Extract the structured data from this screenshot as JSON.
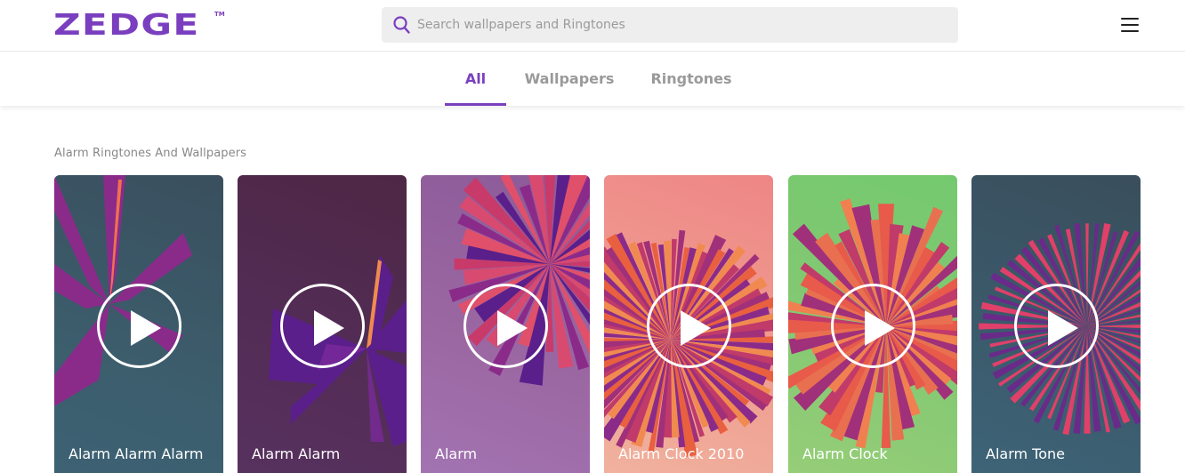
{
  "header": {
    "logo_text": "ZEDGE",
    "logo_tm": "TM",
    "search": {
      "placeholder": "Search wallpapers and Ringtones",
      "value": ""
    },
    "menu_icon": "hamburger-menu-icon"
  },
  "tabs": [
    {
      "label": "All",
      "active": true
    },
    {
      "label": "Wallpapers",
      "active": false
    },
    {
      "label": "Ringtones",
      "active": false
    }
  ],
  "section": {
    "title": "Alarm Ringtones And Wallpapers",
    "items": [
      {
        "title": "Alarm Alarm Alarm",
        "type": "ringtone",
        "icon": "play-icon"
      },
      {
        "title": "Alarm Alarm",
        "type": "ringtone",
        "icon": "play-icon"
      },
      {
        "title": "Alarm",
        "type": "ringtone",
        "icon": "play-icon"
      },
      {
        "title": "Alarm Clock 2010",
        "type": "ringtone",
        "icon": "play-icon"
      },
      {
        "title": "Alarm Clock",
        "type": "ringtone",
        "icon": "play-icon"
      },
      {
        "title": "Alarm Tone",
        "type": "ringtone",
        "icon": "play-icon"
      }
    ]
  },
  "colors": {
    "brand": "#7a3fbf",
    "tab_inactive": "#9a9a9a",
    "search_bg": "#eeeeee"
  }
}
